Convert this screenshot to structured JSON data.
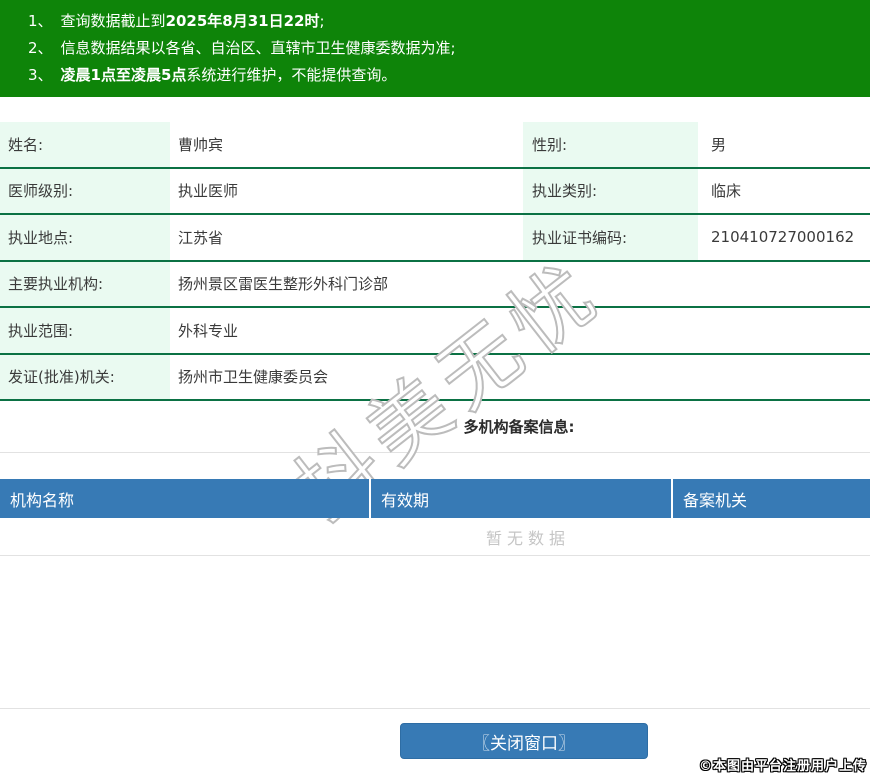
{
  "colors": {
    "header_green": "#0e8409",
    "accent_blue": "#377ab5",
    "label_bg": "#eafaf1",
    "row_border_green": "#0b7144"
  },
  "notice": {
    "items": [
      {
        "num": "1、",
        "pre": "查询数据截止到",
        "bold": "2025年8月31日22时",
        "post": ";"
      },
      {
        "num": "2、",
        "pre": "信息数据结果以各省、自治区、直辖市卫生健康委数据为准;",
        "bold": "",
        "post": ""
      },
      {
        "num": "3、",
        "pre": "",
        "bold": "凌晨1点至凌晨5点",
        "post": "系统进行维护，不能提供查询。"
      }
    ]
  },
  "fields": {
    "name": {
      "label": "姓名:",
      "value": "曹帅宾"
    },
    "gender": {
      "label": "性别:",
      "value": "男"
    },
    "level": {
      "label": "医师级别:",
      "value": "执业医师"
    },
    "category": {
      "label": "执业类别:",
      "value": "临床"
    },
    "location": {
      "label": "执业地点:",
      "value": "江苏省"
    },
    "cert_no": {
      "label": "执业证书编码:",
      "value": "210410727000162"
    },
    "main_org": {
      "label": "主要执业机构:",
      "value": "扬州景区雷医生整形外科门诊部"
    },
    "scope": {
      "label": "执业范围:",
      "value": "外科专业"
    },
    "issuer": {
      "label": "发证(批准)机关:",
      "value": "扬州市卫生健康委员会"
    }
  },
  "multi_org": {
    "heading": "多机构备案信息:",
    "columns": [
      "机构名称",
      "有效期",
      "备案机关"
    ],
    "empty_text": "暂无数据"
  },
  "footer": {
    "close_button": "〖关闭窗口〗",
    "upload_note": "©本图由平台注册用户上传"
  },
  "watermark": {
    "text": "抖美无忧"
  }
}
